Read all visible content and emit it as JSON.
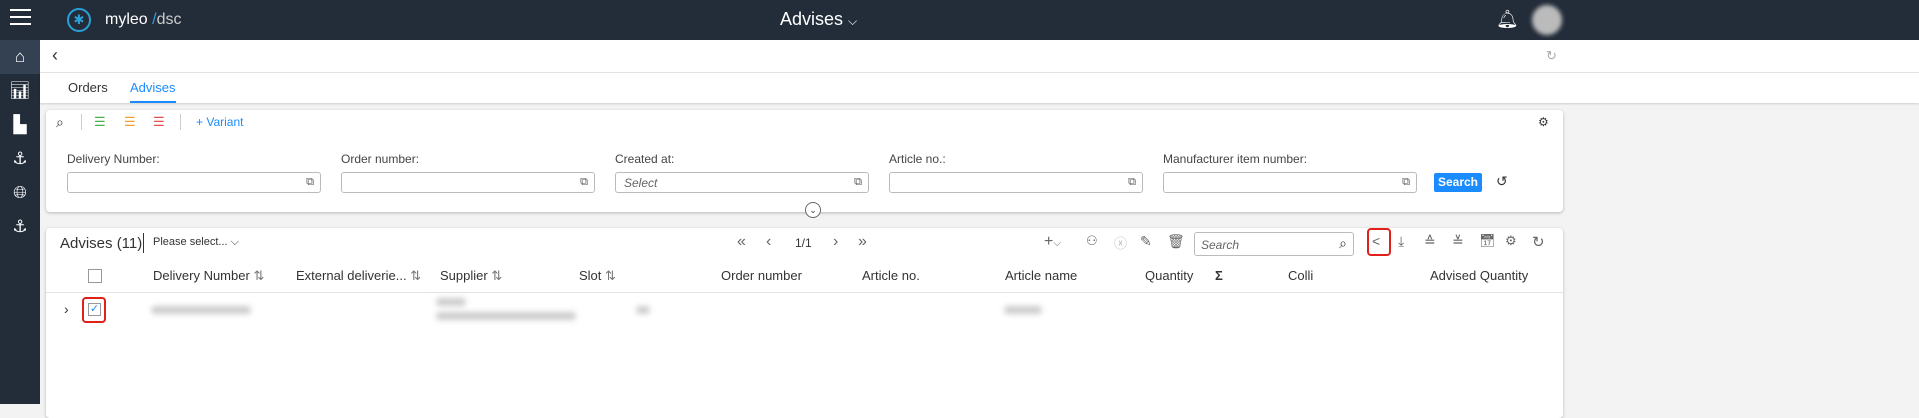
{
  "header": {
    "logo_main": "myleo",
    "logo_sep": "/",
    "logo_sub": "dsc",
    "title": "Advises"
  },
  "tabs": [
    {
      "label": "Orders"
    },
    {
      "label": "Advises"
    }
  ],
  "filter": {
    "variant_label": "+ Variant",
    "fields": [
      {
        "label": "Delivery Number:",
        "value": ""
      },
      {
        "label": "Order number:",
        "value": ""
      },
      {
        "label": "Created at:",
        "placeholder": "Select"
      },
      {
        "label": "Article no.:",
        "value": ""
      },
      {
        "label": "Manufacturer item number:",
        "value": ""
      }
    ],
    "search_label": "Search"
  },
  "table": {
    "title": "Advises (11)",
    "view_select": "Please select...",
    "page": "1/1",
    "search_placeholder": "Search",
    "columns": [
      "Delivery Number",
      "External deliverie...",
      "Supplier",
      "Slot",
      "Order number",
      "Article no.",
      "Article name",
      "Quantity",
      "Σ",
      "Colli",
      "Advised Quantity"
    ]
  },
  "colors": {
    "accent": "#1a8cff",
    "topbar": "#232d3a",
    "highlight": "#e0201a"
  }
}
